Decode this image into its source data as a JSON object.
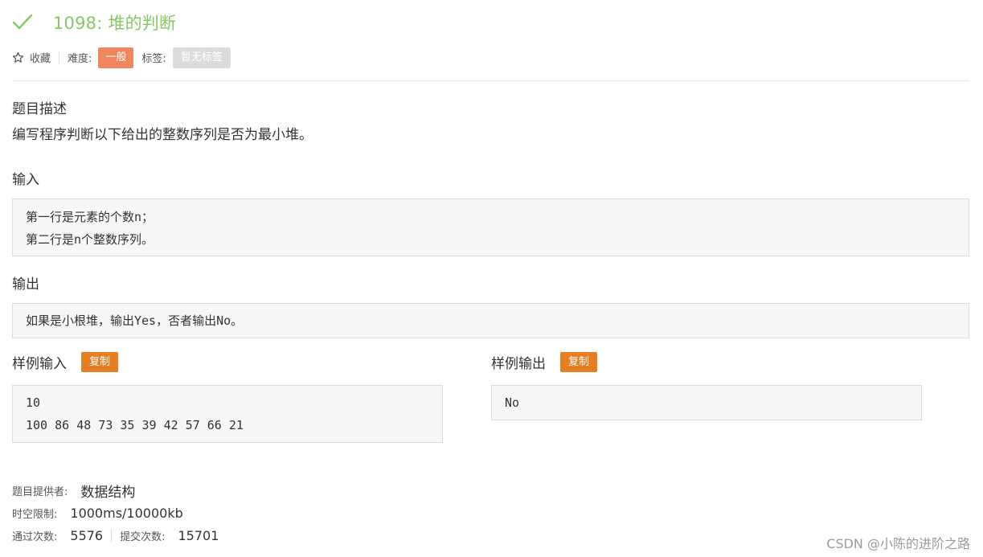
{
  "problem": {
    "title": "1098: 堆的判断",
    "favorite_label": "收藏",
    "difficulty_label": "难度:",
    "difficulty_value": "一般",
    "tags_label": "标签:",
    "tags_value": "暂无标签"
  },
  "description": {
    "heading": "题目描述",
    "text": "编写程序判断以下给出的整数序列是否为最小堆。"
  },
  "input": {
    "heading": "输入",
    "lines": [
      "第一行是元素的个数n；",
      "第二行是n个整数序列。"
    ]
  },
  "output": {
    "heading": "输出",
    "lines": [
      "如果是小根堆，输出Yes，否者输出No。"
    ]
  },
  "sample_input": {
    "heading": "样例输入",
    "copy_label": "复制",
    "lines": [
      "10",
      "100 86 48 73 35 39 42 57 66 21"
    ]
  },
  "sample_output": {
    "heading": "样例输出",
    "copy_label": "复制",
    "lines": [
      "No"
    ]
  },
  "info": {
    "provider_label": "题目提供者:",
    "provider_value": "数据结构",
    "limit_label": "时空限制:",
    "limit_value": "1000ms/10000kb",
    "passed_label": "通过次数:",
    "passed_value": "5576",
    "submitted_label": "提交次数:",
    "submitted_value": "15701"
  },
  "watermark": "CSDN @小陈的进阶之路",
  "colors": {
    "solved_green": "#88c765",
    "difficulty_orange": "#f0865c",
    "copy_orange": "#e67e22",
    "tag_gray": "#dcdcdc"
  },
  "icons": {
    "title_status": "check-icon",
    "favorite": "star-outline-icon"
  }
}
